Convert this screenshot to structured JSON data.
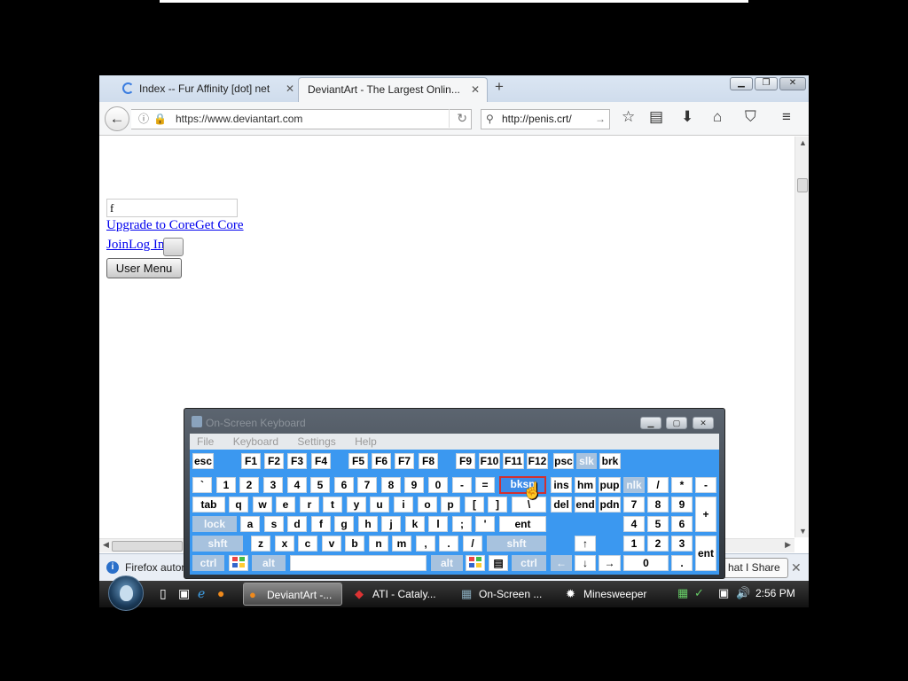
{
  "browser": {
    "tabs": [
      {
        "label": "Index -- Fur Affinity [dot] net"
      },
      {
        "label": "DeviantArt - The Largest Onlin..."
      }
    ],
    "new_tab": "+",
    "url": "https://www.deviantart.com",
    "search_query": "http://penis.crt/",
    "window_controls": [
      "minimize",
      "restore",
      "close"
    ]
  },
  "page": {
    "search_value": "f",
    "upgrade_link": "Upgrade to CoreGet Core",
    "join_link": "JoinLog In",
    "user_menu_button": "User Menu"
  },
  "notification": {
    "text": "Firefox autor",
    "button": "hat I Share",
    "close": "✕"
  },
  "taskbar": {
    "items": [
      {
        "label": "DeviantArt -...",
        "active": true
      },
      {
        "label": "ATI - Cataly...",
        "active": false
      },
      {
        "label": "On-Screen ...",
        "active": false
      },
      {
        "label": "Minesweeper",
        "active": false
      }
    ],
    "clock": "2:56 PM"
  },
  "keyboard": {
    "title": "On-Screen Keyboard",
    "menu": [
      "File",
      "Keyboard",
      "Settings",
      "Help"
    ],
    "selected_key": "bksp",
    "keys": {
      "esc": "esc",
      "f1": "F1",
      "f2": "F2",
      "f3": "F3",
      "f4": "F4",
      "f5": "F5",
      "f6": "F6",
      "f7": "F7",
      "f8": "F8",
      "f9": "F9",
      "f10": "F10",
      "f11": "F11",
      "f12": "F12",
      "psc": "psc",
      "slk": "slk",
      "brk": "brk",
      "grave": "`",
      "n1": "1",
      "n2": "2",
      "n3": "3",
      "n4": "4",
      "n5": "5",
      "n6": "6",
      "n7": "7",
      "n8": "8",
      "n9": "9",
      "n0": "0",
      "minus": "-",
      "equals": "=",
      "bksp": "bksp",
      "ins": "ins",
      "hm": "hm",
      "pup": "pup",
      "nlk": "nlk",
      "kpdiv": "/",
      "kpmul": "*",
      "kpsub": "-",
      "tab": "tab",
      "q": "q",
      "w": "w",
      "e": "e",
      "r": "r",
      "t": "t",
      "y": "y",
      "u": "u",
      "i": "i",
      "o": "o",
      "p": "p",
      "lbr": "[",
      "rbr": "]",
      "bslash": "\\",
      "del": "del",
      "end": "end",
      "pdn": "pdn",
      "kp7": "7",
      "kp8": "8",
      "kp9": "9",
      "kpadd": "+",
      "lock": "lock",
      "a": "a",
      "s": "s",
      "d": "d",
      "f": "f",
      "g": "g",
      "h": "h",
      "j": "j",
      "k": "k",
      "l": "l",
      "semi": ";",
      "quote": "'",
      "ent": "ent",
      "kp4": "4",
      "kp5": "5",
      "kp6": "6",
      "lshft": "shft",
      "z": "z",
      "x": "x",
      "c": "c",
      "v": "v",
      "b": "b",
      "n": "n",
      "m": "m",
      "comma": ",",
      "period": ".",
      "slash": "/",
      "rshft": "shft",
      "up": "↑",
      "kp1": "1",
      "kp2": "2",
      "kp3": "3",
      "kpent": "ent",
      "lctrl": "ctrl",
      "lalt": "alt",
      "space": "",
      "ralt": "alt",
      "rctrl": "ctrl",
      "left": "←",
      "down": "↓",
      "right": "→",
      "kp0": "0",
      "kpdot": "."
    }
  }
}
